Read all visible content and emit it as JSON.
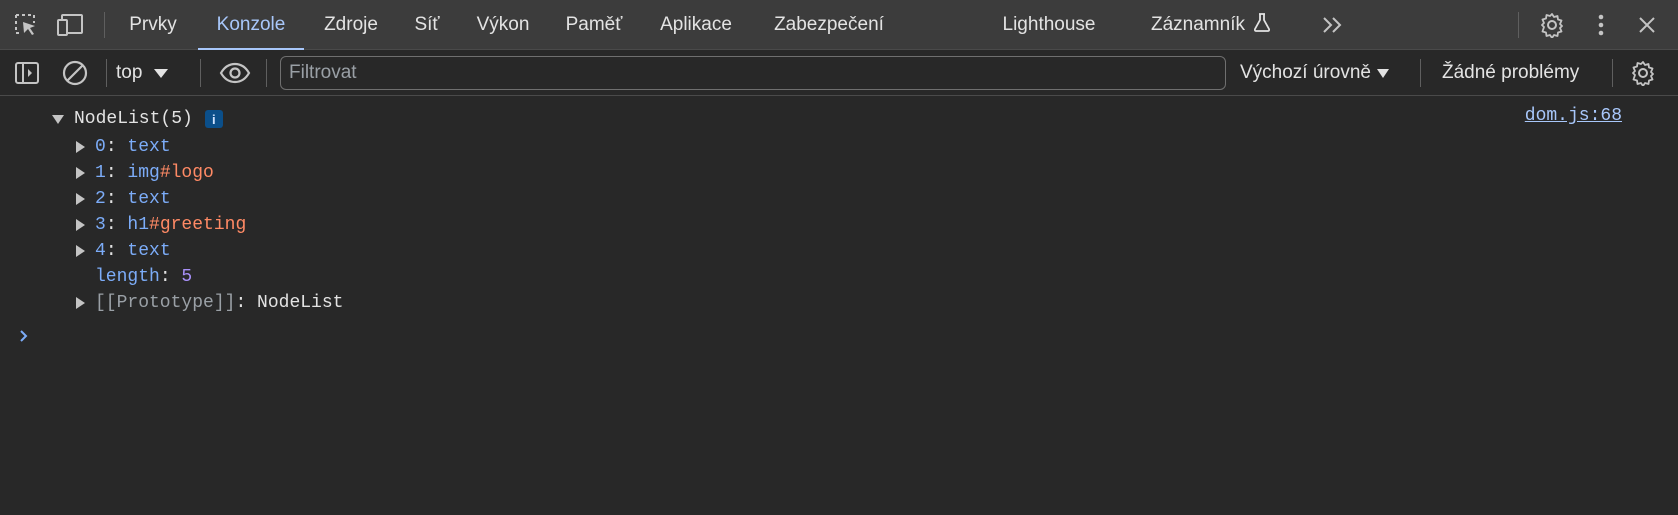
{
  "tabs": [
    {
      "label": "Prvky"
    },
    {
      "label": "Konzole"
    },
    {
      "label": "Zdroje"
    },
    {
      "label": "Síť"
    },
    {
      "label": "Výkon"
    },
    {
      "label": "Paměť"
    },
    {
      "label": "Aplikace"
    },
    {
      "label": "Zabezpečení"
    },
    {
      "label": "Lighthouse"
    },
    {
      "label": "Záznamník"
    }
  ],
  "active_tab": "Konzole",
  "icons": {
    "inspect": "inspect-element-icon",
    "device": "device-toolbar-icon",
    "more_tabs": "more-tabs-chevron-icon",
    "settings": "gear-icon",
    "kebab": "more-options-icon",
    "close": "close-icon",
    "sidebar": "sidebar-toggle-icon",
    "clear": "clear-console-icon",
    "eye": "live-expression-eye-icon",
    "flask": "experimental-flask-icon"
  },
  "toolbar": {
    "context": "top",
    "filter_placeholder": "Filtrovat",
    "levels": "Výchozí úrovně",
    "issues": "Žádné problémy"
  },
  "console": {
    "header": "NodeList(5)",
    "info_badge": "i",
    "source": "dom.js:68",
    "entries": [
      {
        "key": "0",
        "tag": "text",
        "id": ""
      },
      {
        "key": "1",
        "tag": "img",
        "id": "#logo"
      },
      {
        "key": "2",
        "tag": "text",
        "id": ""
      },
      {
        "key": "3",
        "tag": "h1",
        "id": "#greeting"
      },
      {
        "key": "4",
        "tag": "text",
        "id": ""
      }
    ],
    "length_key": "length",
    "length_value": "5",
    "prototype_key": "[[Prototype]]",
    "prototype_value": "NodeList",
    "prompt_symbol": "›"
  },
  "colors": {
    "background": "#282828",
    "tabbar": "#3c3c3c",
    "accent": "#a8c7fa",
    "key": "#7cacf8",
    "id": "#ff8a65",
    "number": "#a890f8"
  }
}
